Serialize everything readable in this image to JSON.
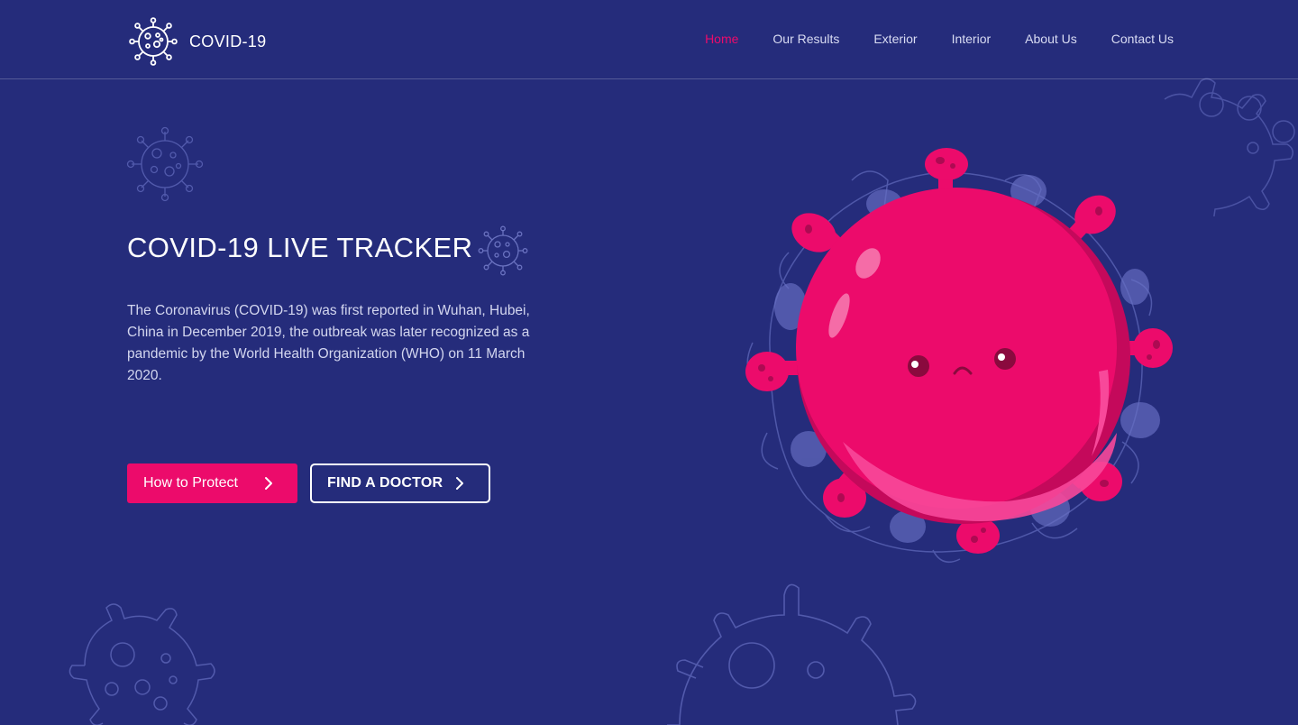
{
  "colors": {
    "background": "#252c7b",
    "accent": "#ec0b6b",
    "nav_text": "#d9dcf3",
    "body_text": "#d3d6ef"
  },
  "header": {
    "logo_icon": "virus-icon",
    "logo_text": "COVID-19",
    "nav": [
      {
        "label": "Home",
        "active": true
      },
      {
        "label": "Our Results",
        "active": false
      },
      {
        "label": "Exterior",
        "active": false
      },
      {
        "label": "Interior",
        "active": false
      },
      {
        "label": "About Us",
        "active": false
      },
      {
        "label": "Contact Us",
        "active": false
      }
    ]
  },
  "hero": {
    "title": "COVID-19 LIVE TRACKER",
    "description": "The Coronavirus (COVID-19) was first reported in Wuhan, Hubei, China in December 2019, the outbreak was later recognized as a pandemic by the World Health Organization (WHO) on 11 March 2020.",
    "primary_button": "How to Protect",
    "secondary_button": "FIND A DOCTOR",
    "button_icon": "chevron-right-icon",
    "illustration": "virus-character-illustration"
  }
}
